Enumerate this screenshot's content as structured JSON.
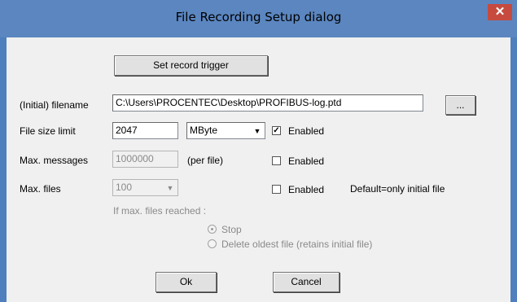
{
  "dialog": {
    "title": "File Recording Setup dialog",
    "close_glyph": "✕"
  },
  "buttons": {
    "set_trigger": "Set record trigger",
    "browse": "...",
    "ok": "Ok",
    "cancel": "Cancel"
  },
  "filename": {
    "label": "(Initial) filename",
    "value": "C:\\Users\\PROCENTEC\\Desktop\\PROFIBUS-log.ptd"
  },
  "size_limit": {
    "label": "File size limit",
    "value": "2047",
    "unit": "MByte",
    "enabled_label": "Enabled",
    "checked": true
  },
  "max_messages": {
    "label": "Max. messages",
    "value": "1000000",
    "suffix": "(per file)",
    "enabled_label": "Enabled",
    "checked": false
  },
  "max_files": {
    "label": "Max. files",
    "value": "100",
    "enabled_label": "Enabled",
    "checked": false,
    "note": "Default=only initial file"
  },
  "reached": {
    "label": "If max. files reached :",
    "stop": "Stop",
    "delete": "Delete oldest file (retains initial file)",
    "selected": "Stop"
  },
  "icons": {
    "check": "check-mark-icon",
    "arrow": "chevron-down-icon"
  }
}
